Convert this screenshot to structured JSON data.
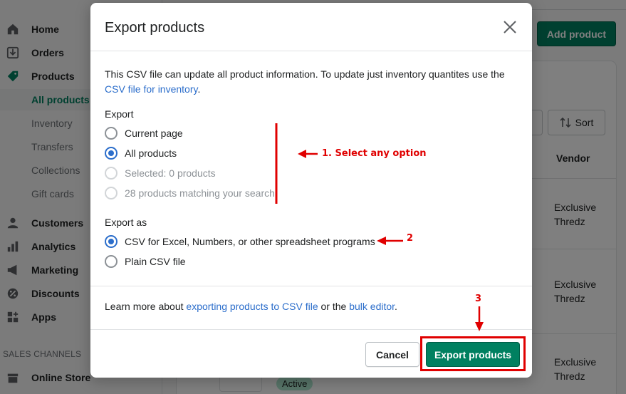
{
  "sidebar": {
    "items": [
      {
        "label": "Home",
        "icon": "home-icon"
      },
      {
        "label": "Orders",
        "icon": "orders-icon"
      },
      {
        "label": "Products",
        "icon": "tag-icon"
      },
      {
        "label": "All products"
      },
      {
        "label": "Inventory"
      },
      {
        "label": "Transfers"
      },
      {
        "label": "Collections"
      },
      {
        "label": "Gift cards"
      },
      {
        "label": "Customers",
        "icon": "person-icon"
      },
      {
        "label": "Analytics",
        "icon": "bar-chart-icon"
      },
      {
        "label": "Marketing",
        "icon": "megaphone-icon"
      },
      {
        "label": "Discounts",
        "icon": "discount-icon"
      },
      {
        "label": "Apps",
        "icon": "apps-icon"
      }
    ],
    "sales_channels_title": "SALES CHANNELS",
    "online_store": "Online Store"
  },
  "header": {
    "add_product": "Add product"
  },
  "table": {
    "sort_label": "Sort",
    "vendor_header": "Vendor",
    "rows": [
      {
        "vendor": "Exclusive Thredz"
      },
      {
        "vendor": "Exclusive Thredz"
      },
      {
        "vendor": "Exclusive Thredz"
      }
    ],
    "status_badge": "Active"
  },
  "modal": {
    "title": "Export products",
    "description_text": "This CSV file can update all product information. To update just inventory quantites use the ",
    "description_link": "CSV file for inventory",
    "description_end": ".",
    "export_label": "Export",
    "export_options": [
      {
        "label": "Current page",
        "checked": false,
        "disabled": false
      },
      {
        "label": "All products",
        "checked": true,
        "disabled": false
      },
      {
        "label": "Selected: 0 products",
        "checked": false,
        "disabled": true
      },
      {
        "label": "28 products matching your search",
        "checked": false,
        "disabled": true
      }
    ],
    "export_as_label": "Export as",
    "export_as_options": [
      {
        "label": "CSV for Excel, Numbers, or other spreadsheet programs",
        "checked": true
      },
      {
        "label": "Plain CSV file",
        "checked": false
      }
    ],
    "learn_prefix": "Learn more about ",
    "learn_link1": "exporting products to CSV file",
    "learn_middle": " or the ",
    "learn_link2": "bulk editor",
    "learn_end": ".",
    "cancel": "Cancel",
    "export_button": "Export products"
  },
  "annotations": {
    "step1": "1. Select any option",
    "step2": "2",
    "step3": "3"
  },
  "colors": {
    "primary": "#008060",
    "link": "#2c6ecb",
    "annotation": "#e00000"
  }
}
